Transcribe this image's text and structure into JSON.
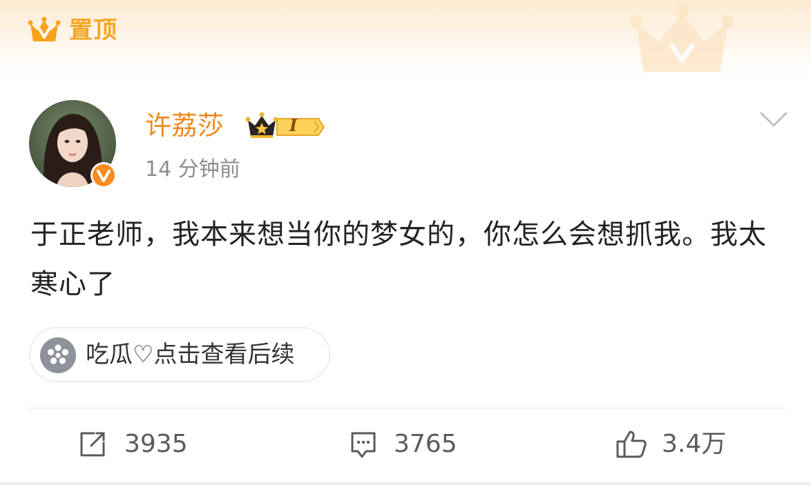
{
  "pinned": {
    "label": "置顶",
    "icon": "crown-v-icon",
    "color": "#f5a623"
  },
  "author": {
    "name": "许荔莎",
    "name_color": "#f08a1d",
    "member_badge_text": "I",
    "timestamp": "14 分钟前",
    "verified": true
  },
  "post": {
    "text": "于正老师，我本来想当你的梦女的，你怎么会想抓我。我太寒心了"
  },
  "topic_chip": {
    "label": "吃瓜♡点击查看后续",
    "icon": "flower-icon"
  },
  "actions": {
    "repost_count": "3935",
    "comment_count": "3765",
    "like_count": "3.4万"
  }
}
